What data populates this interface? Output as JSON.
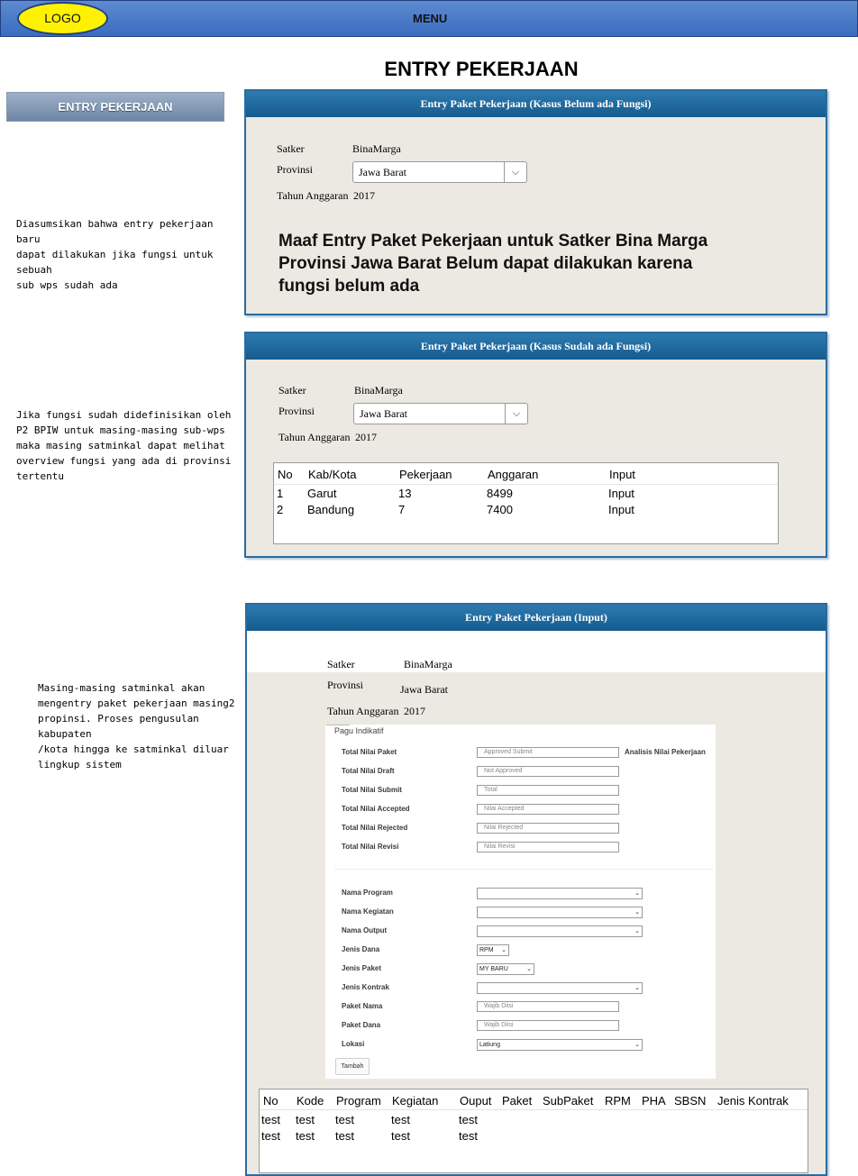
{
  "header": {
    "logo": "LOGO",
    "menu": "MENU"
  },
  "page_title": "ENTRY PEKERJAAN",
  "sidebar": {
    "button": "ENTRY PEKERJAAN"
  },
  "notes": {
    "note1": [
      "Diasumsikan bahwa entry pekerjaan baru",
      "dapat dilakukan jika fungsi untuk sebuah",
      "sub wps sudah ada"
    ],
    "note2": [
      "Jika fungsi sudah didefinisikan oleh",
      "P2 BPIW untuk masing-masing sub-wps",
      "maka masing satminkal dapat melihat",
      "overview fungsi yang ada di provinsi",
      "tertentu"
    ],
    "note3": [
      "Masing-masing satminkal akan",
      "mengentry paket pekerjaan masing2",
      "propinsi. Proses pengusulan kabupaten",
      "/kota hingga ke satminkal diluar",
      "lingkup sistem"
    ]
  },
  "panel1": {
    "title": "Entry Paket Pekerjaan (Kasus Belum ada Fungsi)",
    "satker_label": "Satker",
    "satker_value": "BinaMarga",
    "provinsi_label": "Provinsi",
    "provinsi_value": "Jawa Barat",
    "tahun_label": "Tahun Anggaran",
    "tahun_value": "2017",
    "message": [
      "Maaf Entry Paket Pekerjaan untuk Satker Bina Marga",
      "Provinsi Jawa Barat Belum dapat dilakukan karena",
      "fungsi belum ada"
    ]
  },
  "panel2": {
    "title": "Entry Paket Pekerjaan (Kasus Sudah ada Fungsi)",
    "satker_label": "Satker",
    "satker_value": "BinaMarga",
    "provinsi_label": "Provinsi",
    "provinsi_value": "Jawa Barat",
    "tahun_label": "Tahun Anggaran",
    "tahun_value": "2017",
    "table": {
      "headers": [
        "No",
        "Kab/Kota",
        "Pekerjaan",
        "Anggaran",
        "Input"
      ],
      "rows": [
        [
          "1",
          "Garut",
          "13",
          "8499",
          "Input"
        ],
        [
          "2",
          "Bandung",
          "7",
          "7400",
          "Input"
        ]
      ]
    }
  },
  "panel3": {
    "title": "Entry Paket Pekerjaan (Input)",
    "satker_label": "Satker",
    "satker_value": "BinaMarga",
    "provinsi_label": "Provinsi",
    "provinsi_value": "Jawa Barat",
    "tahun_label": "Tahun Anggaran",
    "tahun_value": "2017",
    "pagu": {
      "tab": "Pagu Indikatif",
      "analisis": "Analisis Nilai Pekerjaan",
      "fields": [
        {
          "label": "Total Nilai Paket",
          "placeholder": "Approved Submit"
        },
        {
          "label": "Total Nilai Draft",
          "placeholder": "Not Approved"
        },
        {
          "label": "Total Nilai Submit",
          "placeholder": "Total"
        },
        {
          "label": "Total Nilai Accepted",
          "placeholder": "Nilai Accepted"
        },
        {
          "label": "Total Nilai Rejected",
          "placeholder": "Nilai Rejected"
        },
        {
          "label": "Total Nilai Revisi",
          "placeholder": "Nilai Revisi"
        }
      ]
    },
    "form": {
      "nama_program": "Nama Program",
      "nama_kegiatan": "Nama Kegiatan",
      "nama_output": "Nama Output",
      "jenis_dana": "Jenis Dana",
      "jenis_dana_value": "RPM",
      "jenis_paket": "Jenis Paket",
      "jenis_paket_value": "MY BARU",
      "jenis_kontrak": "Jenis Kontrak",
      "paket_nama": "Paket Nama",
      "paket_nama_ph": "Wajib Diisi",
      "paket_dana": "Paket Dana",
      "paket_dana_ph": "Wajib Diisi",
      "lokasi": "Lokasi",
      "lokasi_value": "Latiung",
      "tambah": "Tambah"
    },
    "table": {
      "headers": [
        "No",
        "Kode",
        "Program",
        "Kegiatan",
        "Ouput",
        "Paket",
        "SubPaket",
        "RPM",
        "PHA",
        "SBSN",
        "Jenis Kontrak"
      ],
      "rows": [
        [
          "test",
          "test",
          "test",
          "test",
          "test"
        ],
        [
          "test",
          "test",
          "test",
          "test",
          "test"
        ]
      ]
    }
  }
}
